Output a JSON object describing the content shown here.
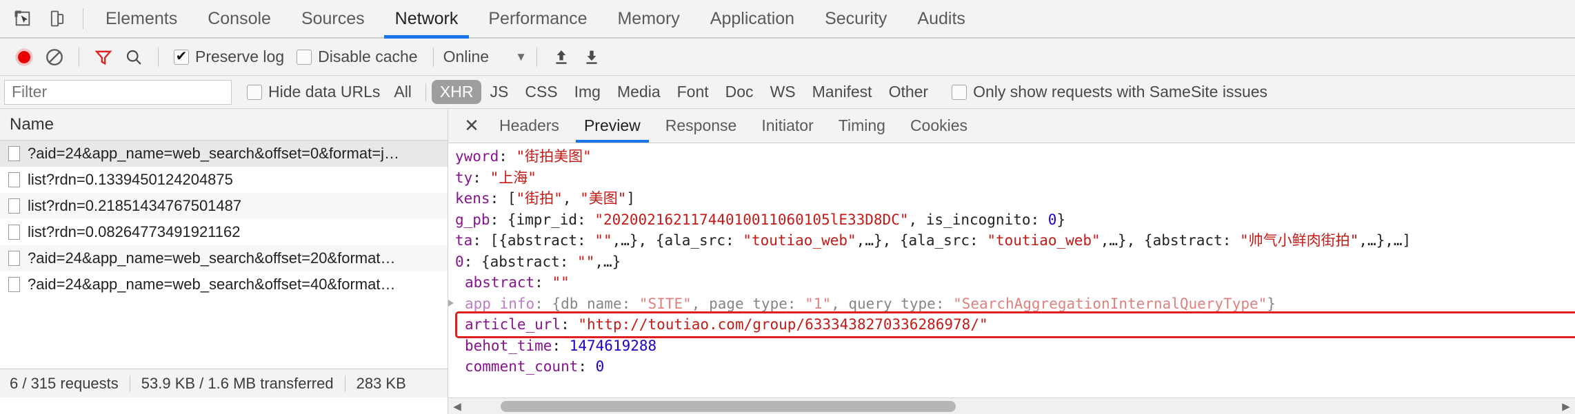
{
  "window": {
    "main_tabs": [
      {
        "label": "Elements",
        "active": false
      },
      {
        "label": "Console",
        "active": false
      },
      {
        "label": "Sources",
        "active": false
      },
      {
        "label": "Network",
        "active": true
      },
      {
        "label": "Performance",
        "active": false
      },
      {
        "label": "Memory",
        "active": false
      },
      {
        "label": "Application",
        "active": false
      },
      {
        "label": "Security",
        "active": false
      },
      {
        "label": "Audits",
        "active": false
      }
    ],
    "inspect_icon": "inspect-element-icon",
    "device_icon": "device-toolbar-icon",
    "accent_color": "#1a73e8"
  },
  "network_toolbar": {
    "record_icon": "record-icon",
    "record_color": "#e60000",
    "clear_icon": "clear-icon",
    "filter_icon": "filter-funnel-icon",
    "filter_active_color": "#e02020",
    "search_icon": "search-icon",
    "preserve_log": {
      "label": "Preserve log",
      "checked": true,
      "tick": "✔"
    },
    "disable_cache": {
      "label": "Disable cache",
      "checked": false
    },
    "throttle": {
      "value": "Online",
      "caret": "▼"
    },
    "import_icon": "upload-har-icon",
    "export_icon": "download-har-icon"
  },
  "filter_bar": {
    "filter_placeholder": "Filter",
    "filter_value": "",
    "hide_data_urls": {
      "label": "Hide data URLs",
      "checked": false
    },
    "types": [
      {
        "label": "All",
        "active": false
      },
      {
        "label": "XHR",
        "active": true
      },
      {
        "label": "JS",
        "active": false
      },
      {
        "label": "CSS",
        "active": false
      },
      {
        "label": "Img",
        "active": false
      },
      {
        "label": "Media",
        "active": false
      },
      {
        "label": "Font",
        "active": false
      },
      {
        "label": "Doc",
        "active": false
      },
      {
        "label": "WS",
        "active": false
      },
      {
        "label": "Manifest",
        "active": false
      },
      {
        "label": "Other",
        "active": false
      }
    ],
    "samesite": {
      "label": "Only show requests with SameSite issues",
      "checked": false
    }
  },
  "request_list": {
    "column_header": "Name",
    "rows": [
      {
        "name": "?aid=24&app_name=web_search&offset=0&format=j…",
        "selected": true
      },
      {
        "name": "list?rdn=0.1339450124204875",
        "selected": false
      },
      {
        "name": "list?rdn=0.21851434767501487",
        "selected": false
      },
      {
        "name": "list?rdn=0.08264773491921162",
        "selected": false
      },
      {
        "name": "?aid=24&app_name=web_search&offset=20&format…",
        "selected": false
      },
      {
        "name": "?aid=24&app_name=web_search&offset=40&format…",
        "selected": false
      }
    ]
  },
  "status_bar": {
    "requests": "6 / 315 requests",
    "transferred": "53.9 KB / 1.6 MB transferred",
    "resources": "283 KB"
  },
  "detail_pane": {
    "close_label": "✕",
    "tabs": [
      {
        "label": "Headers",
        "active": false
      },
      {
        "label": "Preview",
        "active": true
      },
      {
        "label": "Response",
        "active": false
      },
      {
        "label": "Initiator",
        "active": false
      },
      {
        "label": "Timing",
        "active": false
      },
      {
        "label": "Cookies",
        "active": false
      }
    ]
  },
  "preview_json": {
    "highlight_color": "#e02020",
    "lines": [
      {
        "arrow": false,
        "segs": [
          {
            "t": "yword",
            "c": "k-purple"
          },
          {
            "t": ": ",
            "c": "plain"
          },
          {
            "t": "\"街拍美图\"",
            "c": "v-red"
          }
        ]
      },
      {
        "arrow": false,
        "segs": [
          {
            "t": "ty",
            "c": "k-purple"
          },
          {
            "t": ": ",
            "c": "plain"
          },
          {
            "t": "\"上海\"",
            "c": "v-red"
          }
        ]
      },
      {
        "arrow": false,
        "segs": [
          {
            "t": "kens",
            "c": "k-purple"
          },
          {
            "t": ": [",
            "c": "plain"
          },
          {
            "t": "\"街拍\"",
            "c": "v-red"
          },
          {
            "t": ", ",
            "c": "plain"
          },
          {
            "t": "\"美图\"",
            "c": "v-red"
          },
          {
            "t": "]",
            "c": "plain"
          }
        ]
      },
      {
        "arrow": false,
        "segs": [
          {
            "t": "g_pb",
            "c": "k-purple"
          },
          {
            "t": ": {",
            "c": "plain"
          },
          {
            "t": "impr_id",
            "c": "plain"
          },
          {
            "t": ": ",
            "c": "plain"
          },
          {
            "t": "\"20200216211744010011060105lE33D8DC\"",
            "c": "v-red"
          },
          {
            "t": ", ",
            "c": "plain"
          },
          {
            "t": "is_incognito",
            "c": "plain"
          },
          {
            "t": ": ",
            "c": "plain"
          },
          {
            "t": "0",
            "c": "v-blue"
          },
          {
            "t": "}",
            "c": "plain"
          }
        ]
      },
      {
        "arrow": false,
        "segs": [
          {
            "t": "ta",
            "c": "k-purple"
          },
          {
            "t": ": [{",
            "c": "plain"
          },
          {
            "t": "abstract",
            "c": "plain"
          },
          {
            "t": ": ",
            "c": "plain"
          },
          {
            "t": "\"\"",
            "c": "v-red"
          },
          {
            "t": ",…}, {",
            "c": "plain"
          },
          {
            "t": "ala_src",
            "c": "plain"
          },
          {
            "t": ": ",
            "c": "plain"
          },
          {
            "t": "\"toutiao_web\"",
            "c": "v-red"
          },
          {
            "t": ",…}, {",
            "c": "plain"
          },
          {
            "t": "ala_src",
            "c": "plain"
          },
          {
            "t": ": ",
            "c": "plain"
          },
          {
            "t": "\"toutiao_web\"",
            "c": "v-red"
          },
          {
            "t": ",…}, {",
            "c": "plain"
          },
          {
            "t": "abstract",
            "c": "plain"
          },
          {
            "t": ": ",
            "c": "plain"
          },
          {
            "t": "\"帅气小鲜肉街拍\"",
            "c": "v-red"
          },
          {
            "t": ",…},…]",
            "c": "plain"
          }
        ]
      },
      {
        "arrow": false,
        "segs": [
          {
            "t": "0",
            "c": "k-purple"
          },
          {
            "t": ": {",
            "c": "plain"
          },
          {
            "t": "abstract",
            "c": "plain"
          },
          {
            "t": ": ",
            "c": "plain"
          },
          {
            "t": "\"\"",
            "c": "v-red"
          },
          {
            "t": ",…}",
            "c": "plain"
          }
        ]
      },
      {
        "arrow": false,
        "indent": 1,
        "segs": [
          {
            "t": "abstract",
            "c": "k-purple"
          },
          {
            "t": ": ",
            "c": "plain"
          },
          {
            "t": "\"\"",
            "c": "v-red"
          }
        ]
      },
      {
        "arrow": true,
        "indent": 1,
        "faded": true,
        "segs": [
          {
            "t": "app_info",
            "c": "k-purple"
          },
          {
            "t": ": {",
            "c": "plain"
          },
          {
            "t": "db_name",
            "c": "plain"
          },
          {
            "t": ": ",
            "c": "plain"
          },
          {
            "t": "\"SITE\"",
            "c": "v-red"
          },
          {
            "t": ", ",
            "c": "plain"
          },
          {
            "t": "page_type",
            "c": "plain"
          },
          {
            "t": ": ",
            "c": "plain"
          },
          {
            "t": "\"1\"",
            "c": "v-red"
          },
          {
            "t": ", ",
            "c": "plain"
          },
          {
            "t": "query_type",
            "c": "plain"
          },
          {
            "t": ": ",
            "c": "plain"
          },
          {
            "t": "\"SearchAggregationInternalQueryType\"",
            "c": "v-red"
          },
          {
            "t": "}",
            "c": "plain"
          }
        ]
      },
      {
        "arrow": false,
        "indent": 1,
        "highlight": true,
        "segs": [
          {
            "t": "article_url",
            "c": "k-purple"
          },
          {
            "t": ": ",
            "c": "plain"
          },
          {
            "t": "\"http://toutiao.com/group/6333438270336286978/\"",
            "c": "v-red"
          }
        ]
      },
      {
        "arrow": false,
        "indent": 1,
        "segs": [
          {
            "t": "behot_time",
            "c": "k-purple"
          },
          {
            "t": ": ",
            "c": "plain"
          },
          {
            "t": "1474619288",
            "c": "v-blue"
          }
        ]
      },
      {
        "arrow": false,
        "indent": 1,
        "segs": [
          {
            "t": "comment_count",
            "c": "k-purple"
          },
          {
            "t": ": ",
            "c": "plain"
          },
          {
            "t": "0",
            "c": "v-blue"
          }
        ]
      }
    ]
  },
  "scrollbar": {
    "left_arrow": "◀",
    "right_arrow": "▶"
  }
}
